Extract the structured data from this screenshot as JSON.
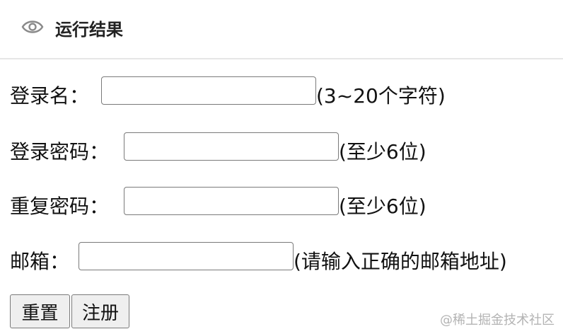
{
  "header": {
    "title": "运行结果",
    "icon": "eye-icon"
  },
  "form": {
    "login_name": {
      "label": "登录名：",
      "value": "",
      "hint": "(3~20个字符)"
    },
    "password": {
      "label": "登录密码：",
      "value": "",
      "hint": "(至少6位)"
    },
    "confirm_password": {
      "label": "重复密码：",
      "value": "",
      "hint": "(至少6位)"
    },
    "email": {
      "label": "邮箱：",
      "value": "",
      "hint": "(请输入正确的邮箱地址)"
    }
  },
  "buttons": {
    "reset": "重置",
    "register": "注册"
  },
  "watermark": "@稀土掘金技术社区"
}
